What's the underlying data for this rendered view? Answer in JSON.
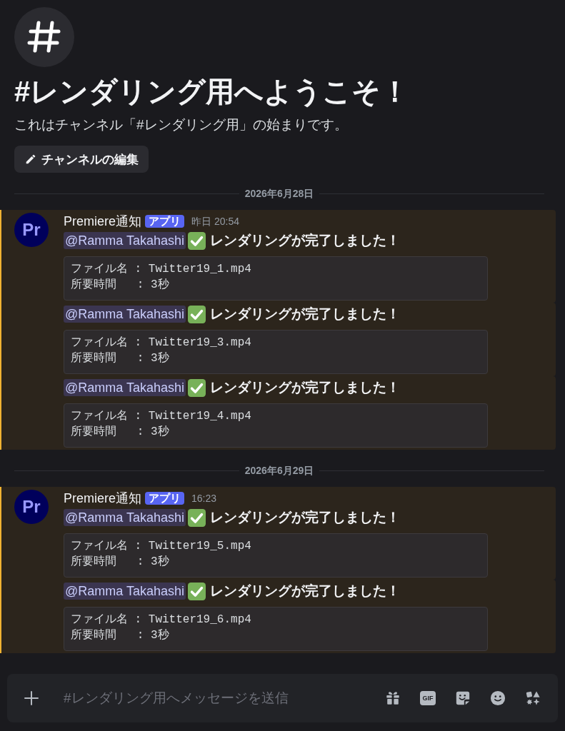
{
  "channel_intro": {
    "title": "#レンダリング用へようこそ！",
    "description": "これはチャンネル「#レンダリング用」の始まりです。",
    "edit_button": "チャンネルの編集"
  },
  "groups": [
    {
      "date": "2026年6月28日",
      "avatar_text": "Pr",
      "author": "Premiere通知",
      "badge": "アプリ",
      "time": "昨日 20:54",
      "messages": [
        {
          "highlighted": true,
          "mention": "@Ramma Takahashi",
          "text": "レンダリングが完了しました！",
          "code_lines": [
            "ファイル名 : Twitter19_1.mp4",
            "所要時間   : 3秒"
          ]
        },
        {
          "highlighted": true,
          "mention": "@Ramma Takahashi",
          "text": "レンダリングが完了しました！",
          "code_lines": [
            "ファイル名 : Twitter19_3.mp4",
            "所要時間   : 3秒"
          ]
        },
        {
          "highlighted": true,
          "mention": "@Ramma Takahashi",
          "text": "レンダリングが完了しました！",
          "code_lines": [
            "ファイル名 : Twitter19_4.mp4",
            "所要時間   : 3秒"
          ]
        }
      ]
    },
    {
      "date": "2026年6月29日",
      "avatar_text": "Pr",
      "author": "Premiere通知",
      "badge": "アプリ",
      "time": "16:23",
      "messages": [
        {
          "highlighted": true,
          "mention": "@Ramma Takahashi",
          "text": "レンダリングが完了しました！",
          "code_lines": [
            "ファイル名 : Twitter19_5.mp4",
            "所要時間   : 3秒"
          ]
        },
        {
          "highlighted": true,
          "mention": "@Ramma Takahashi",
          "text": "レンダリングが完了しました！",
          "code_lines": [
            "ファイル名 : Twitter19_6.mp4",
            "所要時間   : 3秒"
          ]
        }
      ]
    }
  ],
  "composer": {
    "placeholder": "#レンダリング用へメッセージを送信",
    "gif_label": "GIF"
  }
}
